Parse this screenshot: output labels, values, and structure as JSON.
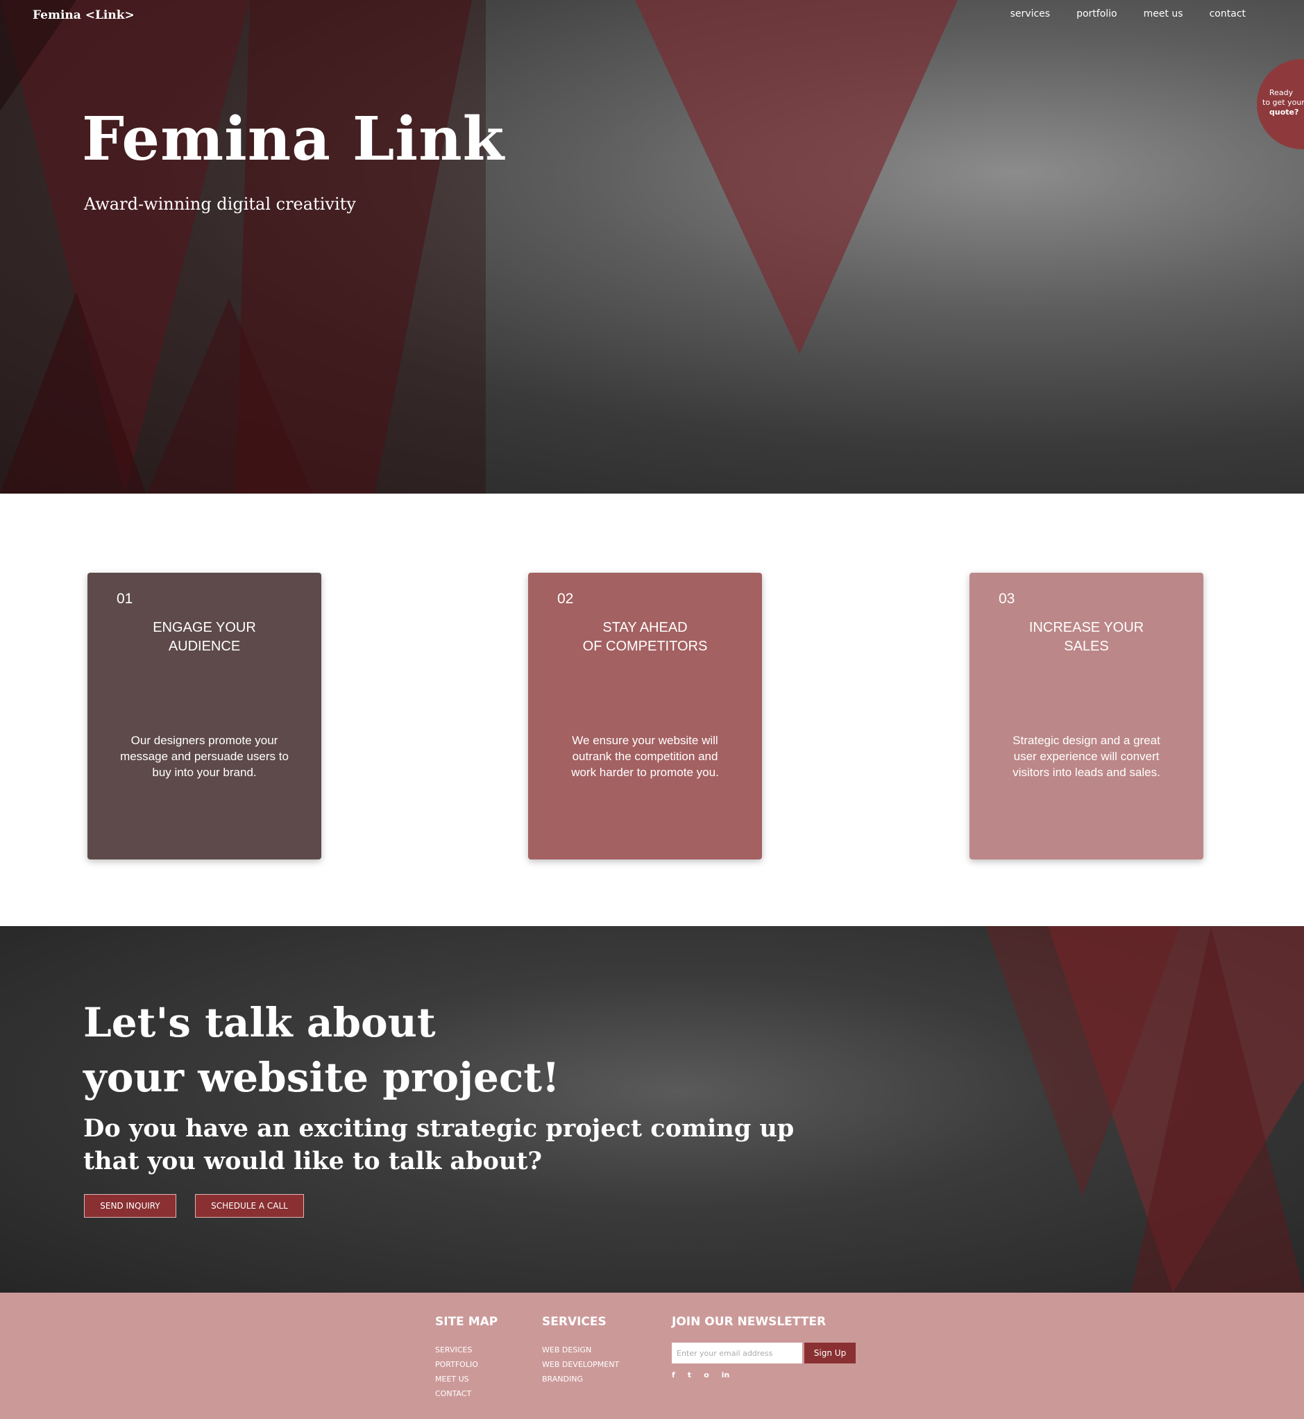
{
  "nav": {
    "logo": "Femina <Link>",
    "links": [
      "services",
      "portfolio",
      "meet us",
      "contact"
    ]
  },
  "quote_badge": {
    "line1": "Ready",
    "line2": "to get your",
    "line3": "quote?"
  },
  "hero": {
    "title": "Femina Link",
    "subtitle": "Award-winning digital creativity"
  },
  "cards": [
    {
      "number": "01",
      "title": "ENGAGE YOUR\nAUDIENCE",
      "description": "Our designers promote your\nmessage and persuade users to\nbuy into your brand.",
      "color": "#5e4a4b"
    },
    {
      "number": "02",
      "title": "STAY AHEAD\nOF COMPETITORS",
      "description": "We ensure your website will\noutrank the competition and\nwork harder to promote you.",
      "color": "#a46162"
    },
    {
      "number": "03",
      "title": "INCREASE YOUR\nSALES",
      "description": "Strategic design and a great\nuser experience will convert\nvisitors into leads and sales.",
      "color": "#bc8788"
    }
  ],
  "cta": {
    "title": "Let's talk about\nyour website project!",
    "subtitle": "Do you have an exciting strategic project coming up\nthat you would like to talk about?",
    "buttons": [
      "SEND INQUIRY",
      "SCHEDULE A CALL"
    ]
  },
  "footer": {
    "sitemap": {
      "heading": "SITE MAP",
      "items": [
        "SERVICES",
        "PORTFOLIO",
        "MEET US",
        "CONTACT"
      ]
    },
    "services": {
      "heading": "SERVICES",
      "items": [
        "WEB DESIGN",
        "WEB DEVELOPMENT",
        "BRANDING"
      ]
    },
    "newsletter": {
      "heading": "JOIN OUR NEWSLETTER",
      "placeholder": "Enter your email address",
      "button": "Sign Up",
      "socials": [
        "f",
        "t",
        "o",
        "in"
      ]
    }
  },
  "colors": {
    "brand_dark": "#8a3032",
    "brand_mid": "#a46162",
    "footer_bg": "#cc9999"
  }
}
